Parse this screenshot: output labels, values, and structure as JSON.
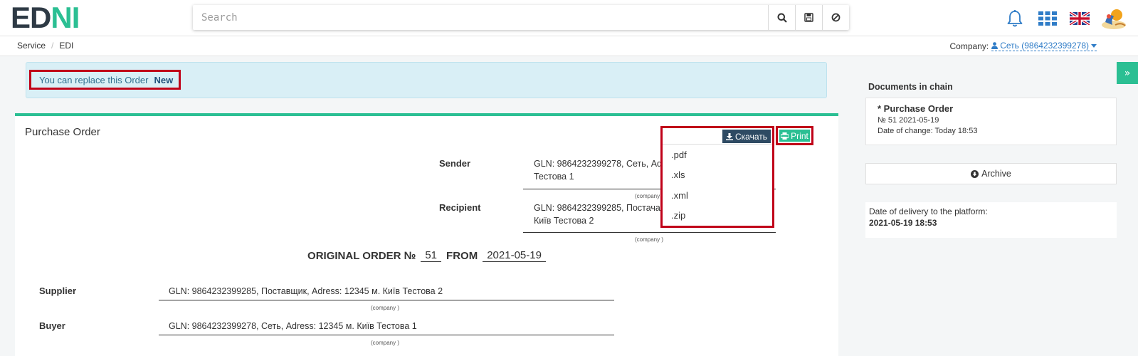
{
  "header": {
    "logo": {
      "part1": "ED",
      "part2": "NI"
    },
    "search": {
      "placeholder": "Search"
    },
    "icons": [
      "search-icon",
      "save-icon",
      "ban-icon",
      "bell-icon",
      "apps-grid-icon",
      "uk-flag-icon",
      "avatar"
    ]
  },
  "breadcrumb": {
    "items": [
      "Service",
      "EDI"
    ]
  },
  "company": {
    "label": "Company:",
    "value": "Сеть (9864232399278)"
  },
  "notice": {
    "text": "You can replace this Order",
    "link": "New"
  },
  "document": {
    "title": "Purchase Order",
    "download": {
      "label": "Скачать",
      "options": [
        ".pdf",
        ".xls",
        ".xml",
        ".zip"
      ]
    },
    "print": {
      "label": "Print"
    },
    "sender": {
      "label": "Sender",
      "line1": "GLN: 9864232399278, Сеть, Adre",
      "line2": "Тестова 1",
      "caption": "(company"
    },
    "recipient": {
      "label": "Recipient",
      "line1": "GLN: 9864232399285, Постачальщ",
      "line2": "Київ Тестова 2",
      "caption": "(company )"
    },
    "order": {
      "title": "ORIGINAL ORDER №",
      "number": "51",
      "from_label": "FROM",
      "date": "2021-05-19"
    },
    "supplier": {
      "label": "Supplier",
      "value": "GLN: 9864232399285, Поставщик, Adress: 12345 м. Київ Тестова 2",
      "caption": "(company )"
    },
    "buyer": {
      "label": "Buyer",
      "value": "GLN: 9864232399278, Сеть, Adress: 12345 м. Київ Тестова 1",
      "caption": "(company )"
    }
  },
  "sidebar": {
    "chain_title": "Documents in chain",
    "chain_doc": {
      "title": "* Purchase Order",
      "number": "№ 51 2021-05-19",
      "date_change": "Date of change: Today 18:53"
    },
    "archive": "Archive",
    "delivery_label": "Date of delivery to the platform:",
    "delivery_date": "2021-05-19 18:53"
  },
  "colors": {
    "accent": "#2bbf93",
    "dark_button": "#2e4a63",
    "highlight": "#c00018",
    "link": "#2f7cc7",
    "notice_bg": "#d9eff6"
  }
}
